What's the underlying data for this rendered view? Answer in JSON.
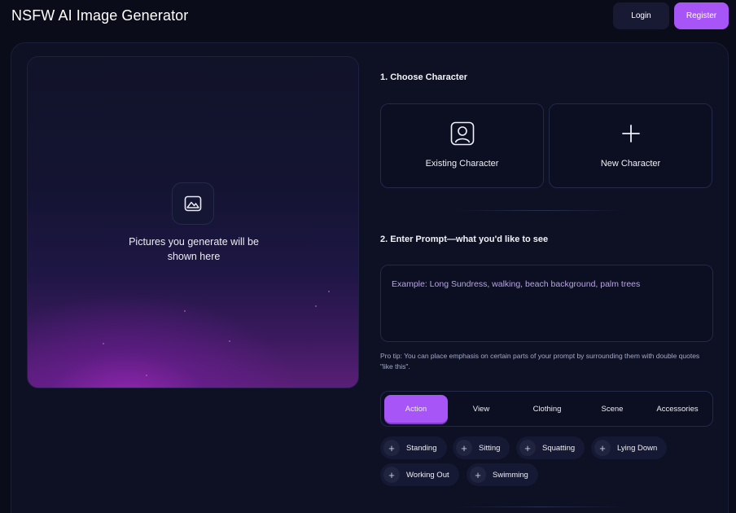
{
  "header": {
    "title": "NSFW AI Image Generator",
    "login_label": "Login",
    "register_label": "Register"
  },
  "preview": {
    "icon": "image-icon",
    "message_line1": "Pictures you generate will be",
    "message_line2": "shown here"
  },
  "character": {
    "section_title": "1. Choose Character",
    "cards": [
      {
        "label": "Existing Character",
        "icon": "user-square-icon"
      },
      {
        "label": "New Character",
        "icon": "plus-icon"
      }
    ]
  },
  "prompt": {
    "section_title": "2. Enter Prompt—what you'd like to see",
    "placeholder": "Example: Long Sundress, walking, beach background, palm trees",
    "value": "",
    "pro_tip": "Pro tip: You can place emphasis on certain parts of your prompt by surrounding them with double quotes \"like this\"."
  },
  "tabs": [
    {
      "label": "Action",
      "active": true
    },
    {
      "label": "View",
      "active": false
    },
    {
      "label": "Clothing",
      "active": false
    },
    {
      "label": "Scene",
      "active": false
    },
    {
      "label": "Accessories",
      "active": false
    }
  ],
  "chips": [
    {
      "label": "Standing"
    },
    {
      "label": "Sitting"
    },
    {
      "label": "Squatting"
    },
    {
      "label": "Lying Down"
    },
    {
      "label": "Working Out"
    },
    {
      "label": "Swimming"
    }
  ],
  "colors": {
    "background": "#0b0c1a",
    "panel": "#0e1024",
    "accent": "#a855f7",
    "login_button": "#181a33"
  }
}
